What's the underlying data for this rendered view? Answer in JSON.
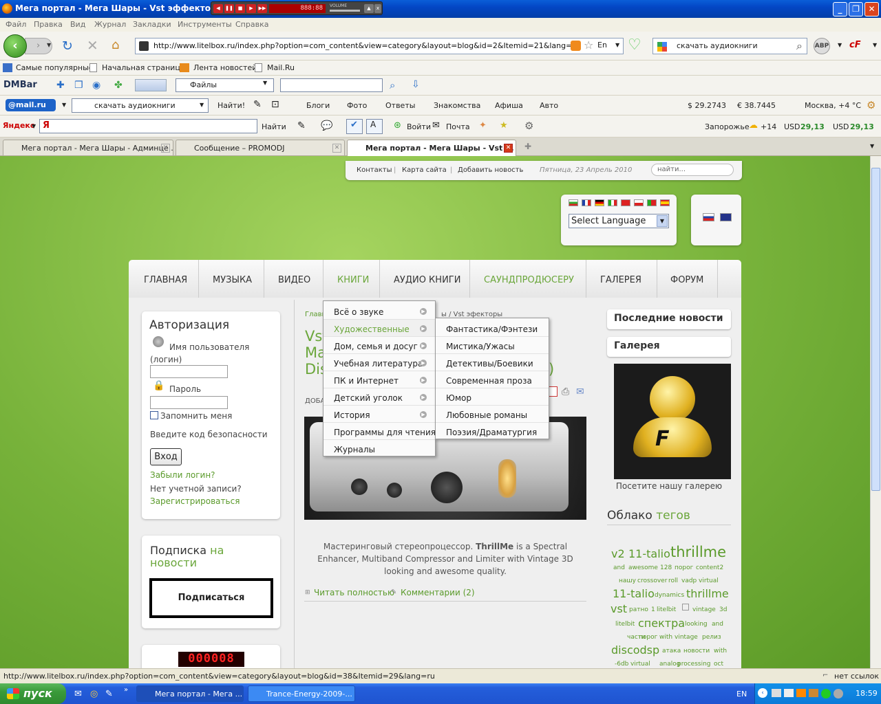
{
  "window": {
    "title": "Мега портал - Мега Шары - Vst эффекторы",
    "player_time": "888:88",
    "player_volume": "VOLUME"
  },
  "menu": [
    "Файл",
    "Правка",
    "Вид",
    "Журнал",
    "Закладки",
    "Инструменты",
    "Справка"
  ],
  "nav": {
    "url": "http://www.litelbox.ru/index.php?option=com_content&view=category&layout=blog&id=2&Itemid=21&lang=ru",
    "search": "скачать аудиокниги",
    "lang_badge": "En",
    "abp": "ABP"
  },
  "bookmarks": [
    "Самые популярные",
    "Начальная страница",
    "Лента новостей",
    "Mail.Ru"
  ],
  "dmbar": {
    "label": "DMBar",
    "files": "Файлы"
  },
  "mailbar": {
    "logo": "@mail.ru",
    "query": "скачать аудиокниги",
    "find": "Найти!",
    "links": [
      "Блоги",
      "Фото",
      "Ответы",
      "Знакомства",
      "Афиша",
      "Авто"
    ],
    "usd": "$ 29.2743",
    "eur": "€ 38.7445",
    "weather": "Москва, +4 °C"
  },
  "yandex": {
    "logo": "Яндекс",
    "find": "Найти",
    "login": "Войти",
    "mail": "Почта",
    "city": "Запорожье",
    "temp": "+14",
    "usd1": "USD",
    "usd1v": "29,13",
    "usd2": "USD",
    "usd2v": "29,13"
  },
  "tabs": [
    "Мега портал - Мега Шары - Админце...",
    "Сообщение – PROMODJ",
    "Мега портал - Мега Шары - Vst ..."
  ],
  "site": {
    "top_links": [
      "Контакты",
      "Карта сайта",
      "Добавить новость"
    ],
    "date": "Пятница, 23 Апрель 2010",
    "search_placeholder": "найти...",
    "select_language": "Select Language",
    "main_nav": [
      "ГЛАВНАЯ",
      "МУЗЫКА",
      "ВИДЕО",
      "КНИГИ",
      "АУДИО КНИГИ",
      "САУНДПРОДЮСЕРУ",
      "ГАЛЕРЕЯ",
      "ФОРУМ"
    ],
    "auth": {
      "title": "Авторизация",
      "username": "Имя пользователя (логин)",
      "password": "Пароль",
      "remember": "Запомнить меня",
      "captcha": "Введите код безопасности",
      "login_btn": "Вход",
      "forgot": "Забыли логин?",
      "no_account": "Нет учетной записи?",
      "register": "Зарегистрироваться"
    },
    "subscribe": {
      "title1": "Подписка",
      "title2": "на",
      "title3": "новости",
      "button": "Подписаться"
    },
    "counter": "000008",
    "breadcrumb_start": "Главн",
    "breadcrumb_end": "ы / Vst эфекторы",
    "article_title_frag": [
      "Vst",
      "Ma",
      "Dis"
    ],
    "article_title_tail": ")",
    "added": "ДОБА",
    "article_text_1": "Мастеринговый стереопроцессор.",
    "article_text_bold": "ThrillMe",
    "article_text_2": "is a Spectral Enhancer, Multiband Compressor and Limiter with Vintage 3D looking and awesome quality.",
    "read_more": "Читать полностью",
    "comments": "Комментарии (2)",
    "dropdown": [
      "Всё о звуке",
      "Художественные",
      "Дом, семья и досуг",
      "Учебная литература",
      "ПК и Интернет",
      "Детский уголок",
      "История",
      "Программы для чтения",
      "Журналы"
    ],
    "submenu": [
      "Фантастика/Фэнтези",
      "Мистика/Ужасы",
      "Детективы/Боевики",
      "Современная проза",
      "Юмор",
      "Любовные романы",
      "Поэзия/Драматургия"
    ],
    "sidebar": {
      "news": "Последние новости",
      "gallery": "Галерея",
      "gallery_caption": "Посетите нашу галерею",
      "cloud_title1": "Облако",
      "cloud_title2": "тегов"
    },
    "cloud": [
      "v2",
      "11-talio",
      "thrillme",
      "and",
      "awesome",
      "128",
      "порог",
      "content2",
      "нашу",
      "crossover",
      "roll",
      "vadp",
      "virtual",
      "11-talio",
      "dynamics",
      "thrillme",
      "vst",
      "ратно",
      "1",
      "litelbit",
      "vintage",
      "3d",
      "litelbit",
      "спектра",
      "looking",
      "and",
      "части",
      "порог",
      "with",
      "vintage",
      "релиз",
      "discodsp",
      "атака",
      "новости",
      "with",
      "-6db",
      "virtual",
      "analog",
      "processing",
      "oct"
    ]
  },
  "status": {
    "url": "http://www.litelbox.ru/index.php?option=com_content&view=category&layout=blog&id=38&Itemid=29&lang=ru",
    "links": "нет ссылок"
  },
  "taskbar": {
    "start": "пуск",
    "items": [
      "Мега портал - Мега ...",
      "Trance-Energy-2009-..."
    ],
    "lang": "EN",
    "time": "18:59"
  }
}
